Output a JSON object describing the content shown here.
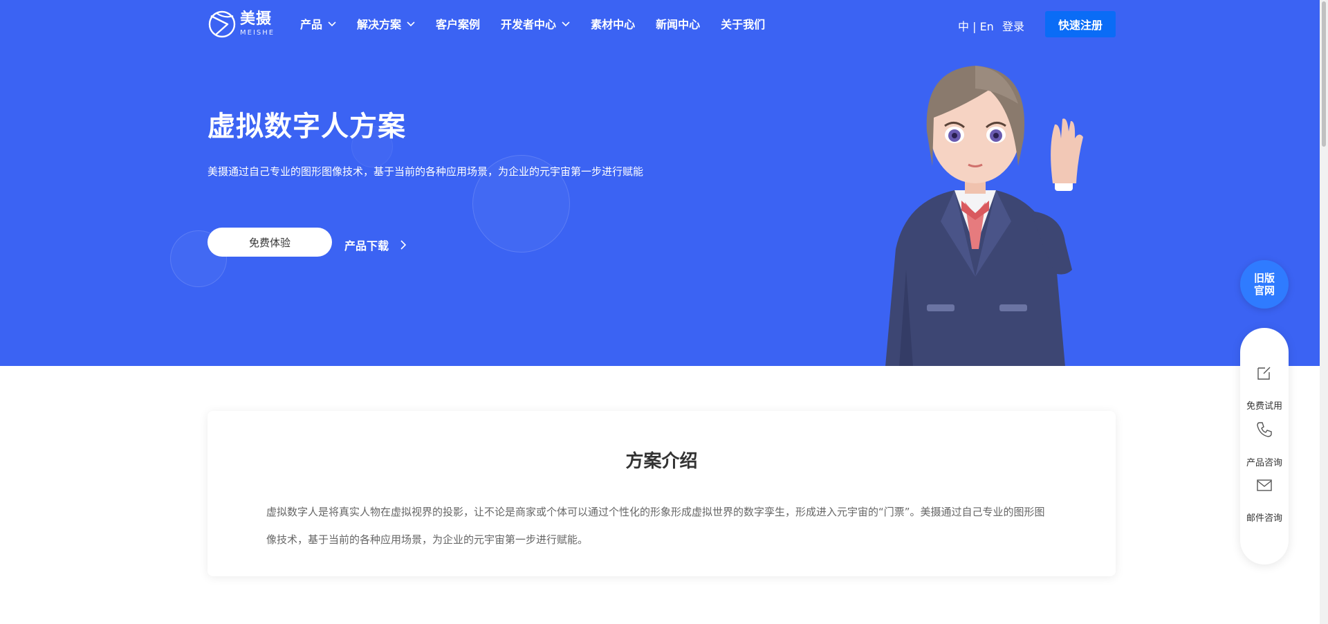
{
  "brand": {
    "name_cn": "美摄",
    "name_en": "MEISHE"
  },
  "nav": {
    "items": [
      {
        "label": "产品",
        "has_dropdown": true
      },
      {
        "label": "解决方案",
        "has_dropdown": true
      },
      {
        "label": "客户案例",
        "has_dropdown": false
      },
      {
        "label": "开发者中心",
        "has_dropdown": true
      },
      {
        "label": "素材中心",
        "has_dropdown": false
      },
      {
        "label": "新闻中心",
        "has_dropdown": false
      },
      {
        "label": "关于我们",
        "has_dropdown": false
      }
    ],
    "lang": "中 | En",
    "login": "登录",
    "register": "快速注册"
  },
  "hero": {
    "title": "虚拟数字人方案",
    "subtitle": "美摄通过自己专业的图形图像技术，基于当前的各种应用场景，为企业的元宇宙第一步进行赋能",
    "trial_button": "免费体验",
    "download_link": "产品下载"
  },
  "intro": {
    "title": "方案介绍",
    "text": "虚拟数字人是将真实人物在虚拟视界的投影，让不论是商家或个体可以通过个性化的形象形成虚拟世界的数字孪生，形成进入元宇宙的“门票”。美摄通过自己专业的图形图像技术，基于当前的各种应用场景，为企业的元宇宙第一步进行赋能。"
  },
  "side": {
    "old_site_line1": "旧版",
    "old_site_line2": "官网",
    "items": [
      {
        "label": "免费试用",
        "icon": "edit-icon"
      },
      {
        "label": "产品咨询",
        "icon": "phone-icon"
      },
      {
        "label": "邮件咨询",
        "icon": "mail-icon"
      }
    ]
  },
  "colors": {
    "hero_bg": "#3b63f3",
    "register_bg": "#0a6cf6",
    "old_site_bg": "#2f7bff"
  }
}
